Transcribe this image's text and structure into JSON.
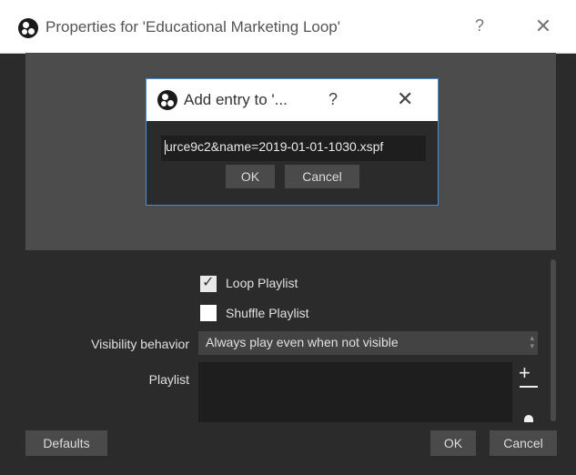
{
  "window": {
    "title": "Properties for 'Educational Marketing Loop'",
    "help_label": "?",
    "close_label": "✕"
  },
  "modal": {
    "title": "Add entry to '...",
    "help_label": "?",
    "close_label": "✕",
    "input_value": "urce9c2&name=2019-01-01-1030.xspf",
    "ok_label": "OK",
    "cancel_label": "Cancel"
  },
  "settings": {
    "loop_playlist": {
      "label": "Loop Playlist",
      "checked": true
    },
    "shuffle_playlist": {
      "label": "Shuffle Playlist",
      "checked": false
    },
    "visibility_behavior": {
      "label": "Visibility behavior",
      "value": "Always play even when not visible"
    },
    "playlist": {
      "label": "Playlist",
      "add_label": "+"
    }
  },
  "footer": {
    "defaults_label": "Defaults",
    "ok_label": "OK",
    "cancel_label": "Cancel"
  },
  "colors": {
    "dialog_bg": "#2b2b2b",
    "preview_bg": "#4c4c4c",
    "accent": "#4a8cd3",
    "button_bg": "#4a4a4a"
  },
  "icons": {
    "app": "obs-logo-icon",
    "remove": "minus-icon",
    "settings": "gear-icon"
  }
}
